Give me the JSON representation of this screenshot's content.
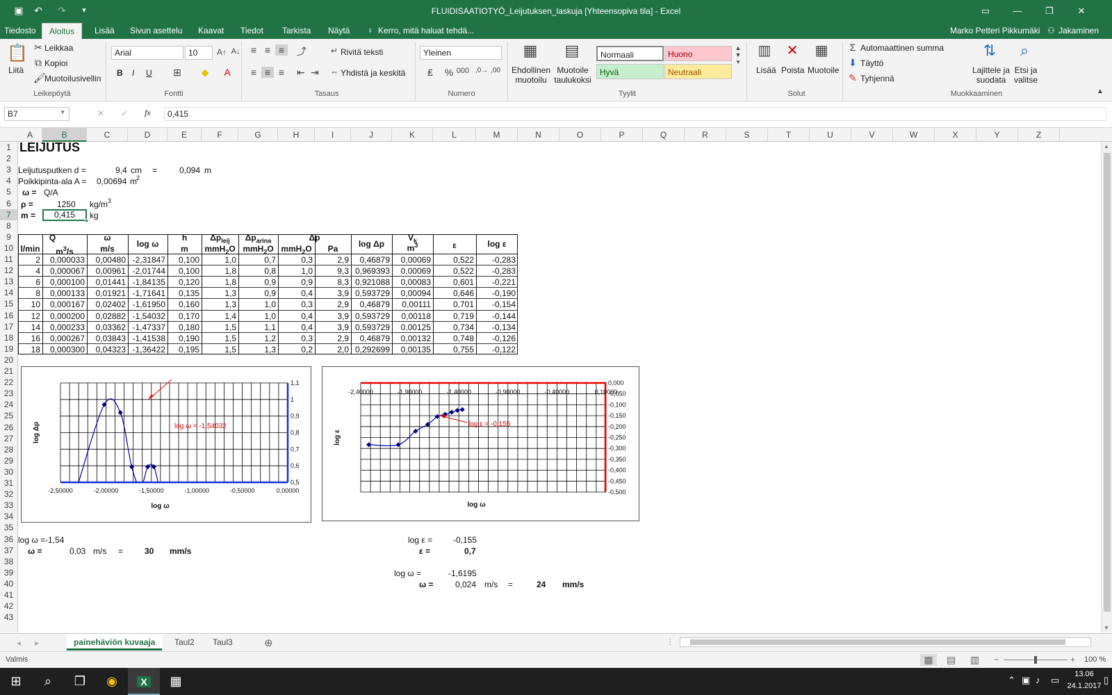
{
  "titlebar": {
    "title": "FLUIDISAATIOTYÖ_Leijutuksen_laskuja  [Yhteensopiva tila]  -  Excel"
  },
  "tabs": [
    "Tiedosto",
    "Aloitus",
    "Lisää",
    "Sivun asettelu",
    "Kaavat",
    "Tiedot",
    "Tarkista",
    "Näytä"
  ],
  "tell_me": "Kerro, mitä haluat tehdä...",
  "user": "Marko Petteri Pikkumäki",
  "share": "Jakaminen",
  "ribbon": {
    "clipboard": {
      "paste": "Liitä",
      "cut": "Leikkaa",
      "copy": "Kopioi",
      "format_painter": "Muotoilusivellin",
      "label": "Leikepöytä"
    },
    "font": {
      "name": "Arial",
      "size": "10",
      "label": "Fontti",
      "bold": "B",
      "italic": "I",
      "underline": "U"
    },
    "alignment": {
      "wrap": "Rivitä teksti",
      "merge": "Yhdistä ja keskitä",
      "label": "Tasaus"
    },
    "number": {
      "format": "Yleinen",
      "label": "Numero"
    },
    "styles": {
      "conditional": "Ehdollinen muotoilu",
      "as_table": "Muotoile taulukoksi",
      "normal": "Normaali",
      "bad": "Huono",
      "good": "Hyvä",
      "neutral": "Neutraali",
      "label": "Tyylit"
    },
    "cells": {
      "insert": "Lisää",
      "delete": "Poista",
      "format": "Muotoile",
      "label": "Solut"
    },
    "editing": {
      "autosum": "Automaattinen summa",
      "fill": "Täyttö",
      "clear": "Tyhjennä",
      "sort": "Lajittele ja suodata",
      "find": "Etsi ja valitse",
      "label": "Muokkaaminen"
    },
    "colors": {
      "excel_green": "#217346",
      "bad_bg": "#ffc7ce",
      "good_bg": "#c6efce",
      "neutral_bg": "#ffeb9c"
    }
  },
  "formula_bar": {
    "name_box": "B7",
    "value": "0,415"
  },
  "columns": [
    "A",
    "B",
    "C",
    "D",
    "E",
    "F",
    "G",
    "H",
    "I",
    "J",
    "K",
    "L",
    "M",
    "N",
    "O",
    "P",
    "Q",
    "R",
    "S",
    "T",
    "U",
    "V",
    "W",
    "X",
    "Y",
    "Z"
  ],
  "sheet": {
    "title": "LEIJUTUS",
    "r3": {
      "label": "Leijutusputken d =",
      "v1": "9,4",
      "u1": "cm",
      "eq": "=",
      "v2": "0,094",
      "u2": "m"
    },
    "r4": {
      "label": "Poikkipinta-ala A =",
      "v": "0,00694",
      "u": "m",
      "sup": "2"
    },
    "r5": {
      "label": "ω =",
      "v": "Q/A"
    },
    "r6": {
      "label": "ρ =",
      "v": "1250",
      "u": "kg/m",
      "sup": "3"
    },
    "r7": {
      "label": "m =",
      "v": "0,415",
      "u": "kg"
    },
    "headers": {
      "Q": "Q",
      "omega": "ω",
      "logw": "log ω",
      "h": "h",
      "dp_leij": "Δp",
      "dp_leij_sub": "leij",
      "dp_arina": "Δp",
      "dp_arina_sub": "arina",
      "dp": "Δp",
      "logdp": "log Δp",
      "Vk": "V",
      "Vk_sub": "k",
      "eps": "ε",
      "logeps": "log ε",
      "u_lmin": "l/min",
      "u_m3s": "m",
      "u_m3s_sup": "3",
      "u_m3s_tail": "/s",
      "u_ms": "m/s",
      "u_m": "m",
      "u_mmh2o_1": "mmH",
      "u_mmh2o_2": "mmH",
      "u_mmh2o_3": "mmH",
      "u_o": "O",
      "u_pa": "Pa",
      "u_m3": "m",
      "u_m3_sup": "3"
    },
    "table": [
      [
        "2",
        "0,000033",
        "0,00480",
        "-2,31847",
        "0,100",
        "1,0",
        "0,7",
        "0,3",
        "2,9",
        "0,46879",
        "0,00069",
        "0,522",
        "-0,283"
      ],
      [
        "4",
        "0,000067",
        "0,00961",
        "-2,01744",
        "0,100",
        "1,8",
        "0,8",
        "1,0",
        "9,3",
        "0,969393",
        "0,00069",
        "0,522",
        "-0,283"
      ],
      [
        "6",
        "0,000100",
        "0,01441",
        "-1,84135",
        "0,120",
        "1,8",
        "0,9",
        "0,9",
        "8,3",
        "0,921088",
        "0,00083",
        "0,601",
        "-0,221"
      ],
      [
        "8",
        "0,000133",
        "0,01921",
        "-1,71641",
        "0,135",
        "1,3",
        "0,9",
        "0,4",
        "3,9",
        "0,593729",
        "0,00094",
        "0,646",
        "-0,190"
      ],
      [
        "10",
        "0,000167",
        "0,02402",
        "-1,61950",
        "0,160",
        "1,3",
        "1,0",
        "0,3",
        "2,9",
        "0,46879",
        "0,00111",
        "0,701",
        "-0,154"
      ],
      [
        "12",
        "0,000200",
        "0,02882",
        "-1,54032",
        "0,170",
        "1,4",
        "1,0",
        "0,4",
        "3,9",
        "0,593729",
        "0,00118",
        "0,719",
        "-0,144"
      ],
      [
        "14",
        "0,000233",
        "0,03362",
        "-1,47337",
        "0,180",
        "1,5",
        "1,1",
        "0,4",
        "3,9",
        "0,593729",
        "0,00125",
        "0,734",
        "-0,134"
      ],
      [
        "16",
        "0,000267",
        "0,03843",
        "-1,41538",
        "0,190",
        "1,5",
        "1,2",
        "0,3",
        "2,9",
        "0,46879",
        "0,00132",
        "0,748",
        "-0,126"
      ],
      [
        "18",
        "0,000300",
        "0,04323",
        "-1,36422",
        "0,195",
        "1,5",
        "1,3",
        "0,2",
        "2,0",
        "0,292699",
        "0,00135",
        "0,755",
        "-0,122"
      ]
    ],
    "r36": {
      "label": "log ω =-1,54",
      "eps_label": "log ε =",
      "eps_val": "-0,155"
    },
    "r37": {
      "label": "ω =",
      "v": "0,03",
      "u": "m/s",
      "eq": "=",
      "v2": "30",
      "u2": "mm/s",
      "eps_label": "ε =",
      "eps_val": "0,7"
    },
    "r39": {
      "label": "log ω =",
      "v": "-1,6195"
    },
    "r40": {
      "label": "ω =",
      "v": "0,024",
      "u": "m/s",
      "eq": "=",
      "v2": "24",
      "u2": "mm/s"
    }
  },
  "chart_data": [
    {
      "type": "line",
      "xlabel": "log ω",
      "ylabel": "log Δp",
      "x": [
        -2.31847,
        -2.01744,
        -1.84135,
        -1.71641,
        -1.6195,
        -1.54032,
        -1.47337,
        -1.41538,
        -1.36422
      ],
      "y": [
        0.46879,
        0.969393,
        0.921088,
        0.593729,
        0.46879,
        0.593729,
        0.593729,
        0.46879,
        0.292699
      ],
      "xlim": [
        -2.5,
        0
      ],
      "ylim": [
        0.5,
        1.1
      ],
      "xticks": [
        "-2,50000",
        "-2,00000",
        "-1,50000",
        "-1,00000",
        "-0,50000",
        "0,00000"
      ],
      "yticks": [
        "0,5",
        "0,6",
        "0,7",
        "0,8",
        "0,9",
        "1",
        "1,1"
      ],
      "annotation": "log ω = -1,54032",
      "grid": true
    },
    {
      "type": "line",
      "xlabel": "log ω",
      "ylabel": "log ε",
      "x": [
        -2.31847,
        -2.01744,
        -1.84135,
        -1.71641,
        -1.6195,
        -1.54032,
        -1.47337,
        -1.41538,
        -1.36422
      ],
      "y": [
        -0.283,
        -0.283,
        -0.221,
        -0.19,
        -0.154,
        -0.144,
        -0.134,
        -0.126,
        -0.122
      ],
      "xlim": [
        -2.4,
        0.1
      ],
      "ylim": [
        -0.5,
        0
      ],
      "xticks": [
        "-2,40000",
        "-1,90000",
        "-1,40000",
        "-0,90000",
        "-0,40000",
        "0,10000"
      ],
      "yticks": [
        "0,000",
        "-0,050",
        "-0,100",
        "-0,150",
        "-0,200",
        "-0,250",
        "-0,300",
        "-0,350",
        "-0,400",
        "-0,450",
        "-0,500"
      ],
      "annotation": "log ε = -0,155",
      "grid": true
    }
  ],
  "sheet_tabs": [
    "painehäviön kuvaaja",
    "Taul2",
    "Taul3"
  ],
  "status": {
    "text": "Valmis",
    "zoom": "100 %"
  },
  "taskbar": {
    "time": "13.06",
    "date": "24.1.2017"
  }
}
